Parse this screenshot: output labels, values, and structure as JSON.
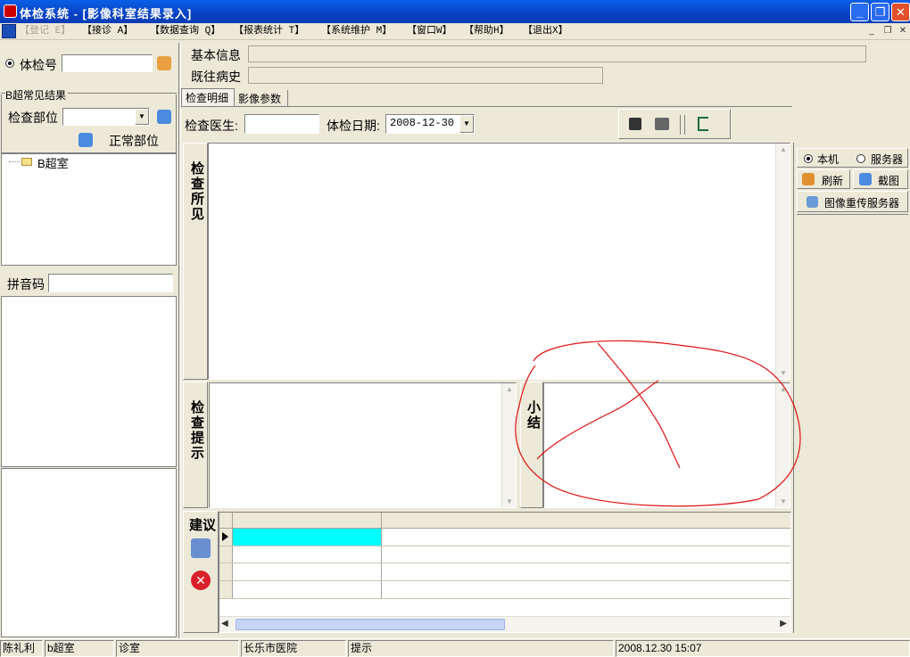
{
  "window": {
    "title": "体检系统 - [影像科室结果录入]"
  },
  "menu": {
    "items": [
      "【登记 E】",
      "【接诊 A】",
      "【数据查询 Q】",
      "【报表统计 T】",
      "【系统维护 M】",
      "【窗口W】",
      "【帮助H】",
      "【退出X】"
    ]
  },
  "left": {
    "radio_label": "体检号",
    "group_title": "B超常见结果",
    "part_label": "检查部位",
    "normal_label": "正常部位",
    "tree_item": "B超室",
    "pinyin_label": "拼音码"
  },
  "info": {
    "basic_label": "基本信息",
    "history_label": "既往病史"
  },
  "tabs": [
    "检查明细",
    "影像参数"
  ],
  "toolbar": {
    "doctor_label": "检查医生:",
    "date_label": "体检日期:",
    "date_value": "2008-12-30"
  },
  "sections": {
    "findings": "检查所见",
    "tips": "检查提示",
    "summary": "小结",
    "advice": "建议"
  },
  "right": {
    "local_label": "本机",
    "server_label": "服务器",
    "refresh_label": "刷新",
    "capture_label": "截图",
    "reupload_label": "图像重传服务器"
  },
  "status": {
    "user": "陈礼利",
    "room": "b超室",
    "dept": "诊室",
    "hospital": "长乐市医院",
    "hint": "提示",
    "datetime": "2008.12.30 15:07"
  },
  "colors": {
    "title": "#0a5fe6",
    "selected_cell": "#00ffff",
    "annotation": "#e01010"
  }
}
